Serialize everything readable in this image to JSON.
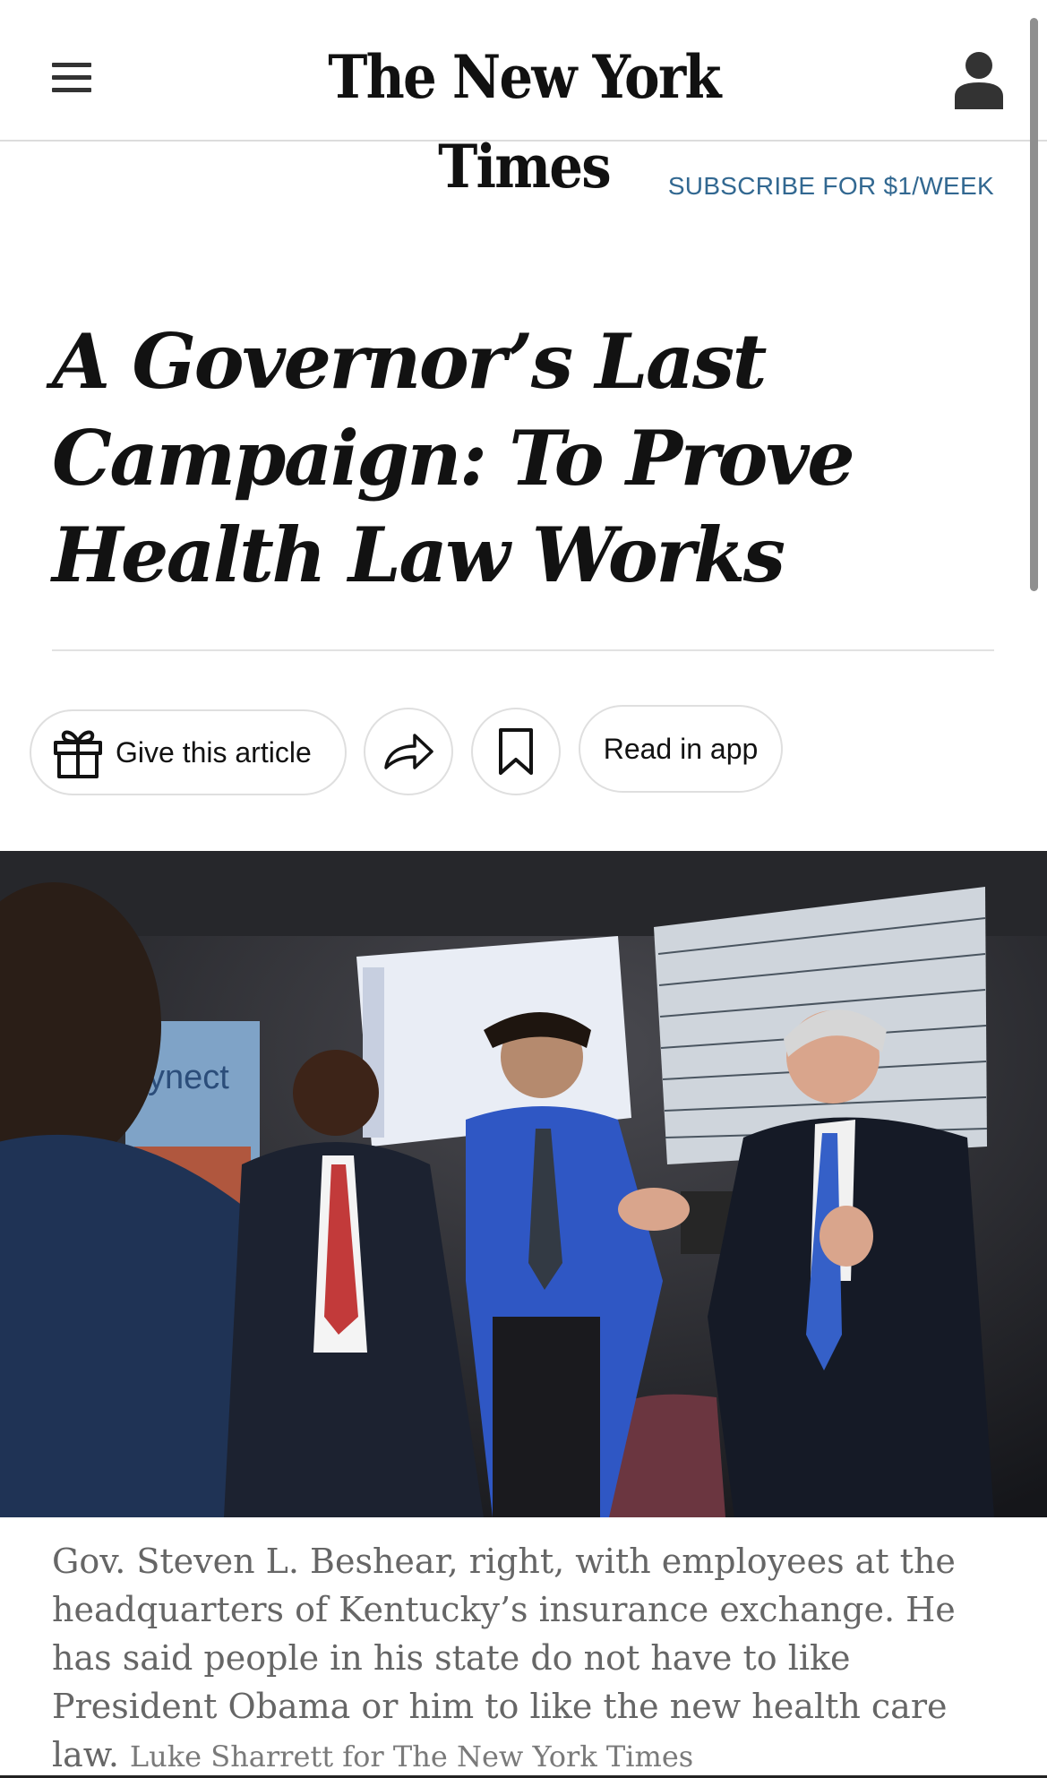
{
  "header": {
    "masthead": "The New York Times",
    "menu_icon": "hamburger-menu-icon",
    "account_icon": "user-account-icon"
  },
  "subscribe": {
    "label": "SUBSCRIBE FOR $1/WEEK"
  },
  "article": {
    "headline": "A Governor’s Last Campaign: To Prove Health Law Works",
    "actions": {
      "gift_label": "Give this article",
      "gift_icon": "gift-icon",
      "share_icon": "share-arrow-icon",
      "save_icon": "bookmark-icon",
      "app_label": "Read in app"
    },
    "photo": {
      "banner_fragment": "ynect",
      "caption": "Gov. Steven L. Beshear, right, with employees at the headquarters of Kentucky’s insurance exchange. He has said people in his state do not have to like President Obama or him to like the new health care law.",
      "credit": "Luke Sharrett for The New York Times"
    }
  },
  "colors": {
    "link": "#326891",
    "caption_text": "#666666",
    "border": "#dfdfdf"
  }
}
